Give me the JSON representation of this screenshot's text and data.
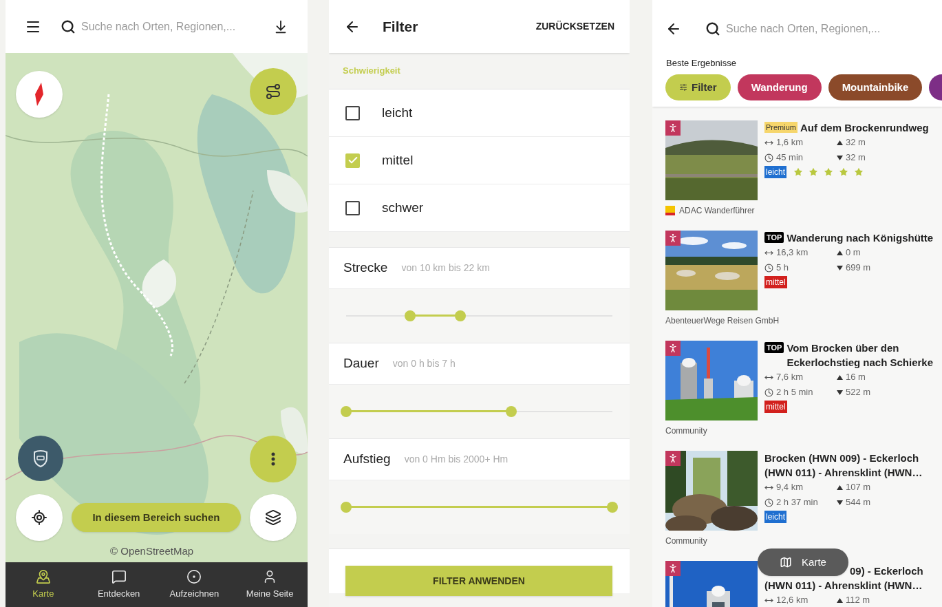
{
  "map_screen": {
    "search": {
      "placeholder": "Suche nach Orten, Regionen,..."
    },
    "search_area_button": "In diesem Bereich suchen",
    "attribution": "© OpenStreetMap",
    "nav": [
      {
        "label": "Karte",
        "selected": true
      },
      {
        "label": "Entdecken",
        "selected": false
      },
      {
        "label": "Aufzeichnen",
        "selected": false
      },
      {
        "label": "Meine Seite",
        "selected": false
      }
    ]
  },
  "filter_screen": {
    "title": "Filter",
    "reset": "ZURÜCKSETZEN",
    "difficulty": {
      "heading": "Schwierigkeit",
      "options": [
        {
          "label": "leicht",
          "checked": false
        },
        {
          "label": "mittel",
          "checked": true
        },
        {
          "label": "schwer",
          "checked": false
        }
      ]
    },
    "ranges": [
      {
        "label": "Strecke",
        "reading": "von 10 km bis 22 km",
        "thumbs": [
          {
            "level": 0.24
          },
          {
            "level": 0.43
          }
        ]
      },
      {
        "label": "Dauer",
        "reading": "von 0 h bis 7 h",
        "thumbs": [
          {
            "level": 0
          },
          {
            "level": 0.62
          }
        ]
      },
      {
        "label": "Aufstieg",
        "reading": "von 0 Hm bis 2000+ Hm",
        "thumbs": [
          {
            "level": 0
          },
          {
            "level": 1
          }
        ]
      }
    ],
    "apply": "FILTER ANWENDEN"
  },
  "search_screen": {
    "search": {
      "placeholder": "Suche nach Orten, Regionen,..."
    },
    "section": "Beste Ergebnisse",
    "chips": [
      {
        "kind": "filter",
        "label": "Filter",
        "color": "#c3cd4e"
      },
      {
        "kind": "sport",
        "label": "Wanderung",
        "color": "#c2375d"
      },
      {
        "kind": "sport",
        "label": "Mountainbike",
        "color": "#8b4a2a"
      },
      {
        "kind": "sport",
        "color": "#7d2e86"
      }
    ],
    "results": [
      {
        "badge": {
          "kind": "premium",
          "label": "Premium"
        },
        "title": "Auf dem Brockenrundweg",
        "distance": "1,6 km",
        "duration": "45 min",
        "ascent": "32 m",
        "descent": "32 m",
        "difficulty": {
          "label": "leicht",
          "color": "#1f6fd0"
        },
        "stars": 5,
        "source": {
          "kind": "logo",
          "label": "ADAC Wanderführer"
        }
      },
      {
        "badge": {
          "kind": "top",
          "label": "TOP"
        },
        "title": "Wanderung nach Königshütte",
        "distance": "16,3 km",
        "duration": "5 h",
        "ascent": "0 m",
        "descent": "699 m",
        "difficulty": {
          "label": "mittel",
          "color": "#d2201d"
        },
        "source": {
          "kind": "plain",
          "label": "AbenteuerWege Reisen GmbH"
        }
      },
      {
        "badge": {
          "kind": "top",
          "label": "TOP"
        },
        "title": "Vom Brocken über den Eckerlochstieg nach Schierke",
        "distance": "7,6 km",
        "duration": "2 h 5 min",
        "ascent": "16 m",
        "descent": "522 m",
        "difficulty": {
          "label": "mittel",
          "color": "#d2201d"
        },
        "source": {
          "kind": "plain",
          "label": "Community"
        }
      },
      {
        "title": "Brocken (HWN 009) - Eckerloch (HWN 011) - Ahrensklint (HWN…",
        "distance": "9,4 km",
        "duration": "2 h 37 min",
        "ascent": "107 m",
        "descent": "544 m",
        "difficulty": {
          "label": "leicht",
          "color": "#1f6fd0"
        },
        "source": {
          "kind": "plain",
          "label": "Community"
        }
      },
      {
        "title_lines": [
          "09) - Eckerloch",
          "(HWN 011) - Ahrensklint (HWN…"
        ],
        "distance": "12,6 km",
        "ascent": "112 m"
      }
    ],
    "map_button": "Karte"
  }
}
